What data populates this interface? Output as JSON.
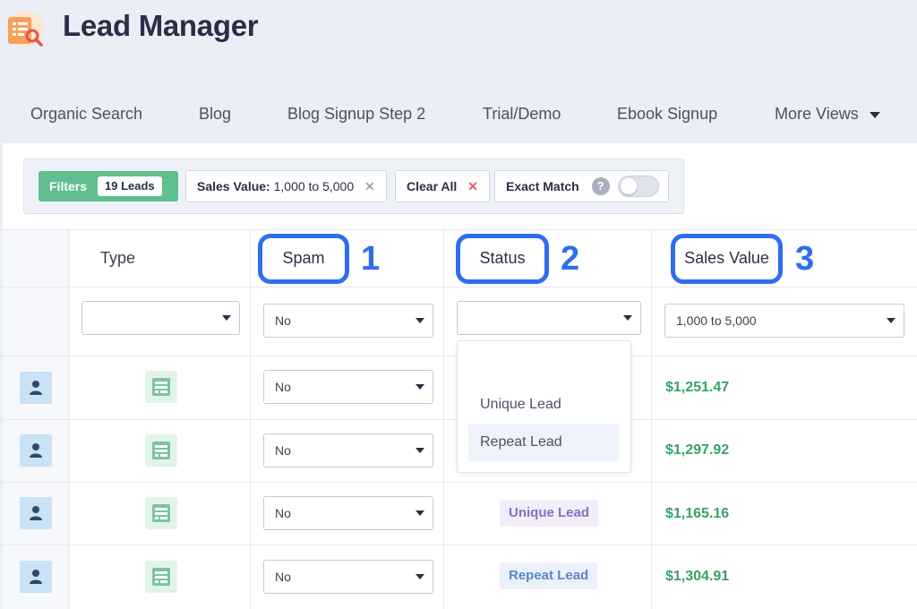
{
  "app": {
    "title": "Lead Manager",
    "logo_icon": "lead-search-icon"
  },
  "tabs": [
    {
      "label": "Organic Search"
    },
    {
      "label": "Blog"
    },
    {
      "label": "Blog Signup Step 2"
    },
    {
      "label": "Trial/Demo"
    },
    {
      "label": "Ebook Signup"
    },
    {
      "label": "More Views"
    }
  ],
  "filters": {
    "label": "Filters",
    "count": "19 Leads",
    "sales_value_key": "Sales Value:",
    "sales_value_val": "1,000 to 5,000",
    "clear_all": "Clear All",
    "exact_match": "Exact Match",
    "help": "?",
    "exact_match_on": false
  },
  "columns": {
    "type": "Type",
    "spam": "Spam",
    "status": "Status",
    "sales_value": "Sales Value"
  },
  "callouts": [
    "1",
    "2",
    "3"
  ],
  "column_filters": {
    "type": "",
    "spam": "No",
    "status": "",
    "sales_value": "1,000 to 5,000"
  },
  "status_dropdown": {
    "options": [
      "Unique Lead",
      "Repeat Lead"
    ],
    "highlighted": "Repeat Lead"
  },
  "rows": [
    {
      "spam": "No",
      "status": "",
      "sales": "$1,251.47"
    },
    {
      "spam": "No",
      "status": "",
      "sales": "$1,297.92"
    },
    {
      "spam": "No",
      "status": "Unique Lead",
      "sales": "$1,165.16"
    },
    {
      "spam": "No",
      "status": "Repeat Lead",
      "sales": "$1,304.91"
    }
  ],
  "colors": {
    "accent": "#2f6cf0",
    "filters_green": "#5fbf8f",
    "sales_green": "#3aa06a",
    "unique_purple": "#8a6dc4",
    "repeat_blue": "#5a86c8",
    "clear_red": "#e05a6d"
  }
}
